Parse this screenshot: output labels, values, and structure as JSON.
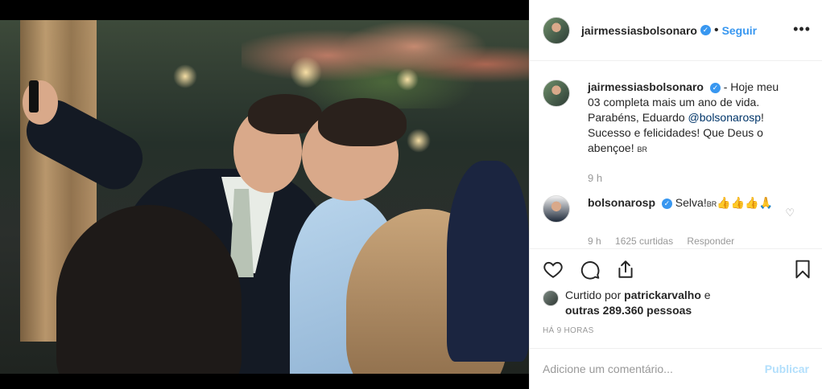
{
  "post": {
    "author": "jairmessiasbolsonaro",
    "verified": true,
    "separator": "•",
    "follow_label": "Seguir",
    "more_icon": "more-horizontal-icon",
    "accent": "#3897f0"
  },
  "caption": {
    "user": "jairmessiasbolsonaro",
    "text_before": " - Hoje meu 03 completa mais um ano de vida. Parabéns, Eduardo ",
    "mention": "@bolsonarosp",
    "text_after": "! Sucesso e felicidades! Que Deus o abençoe! ",
    "flag": "BR",
    "time": "9 h"
  },
  "comment": {
    "user": "bolsonarosp",
    "text": " Selva!",
    "flag": "BR",
    "emoji": "👍👍👍🙏",
    "meta_time": "9 h",
    "meta_likes": "1625 curtidas",
    "meta_reply": "Responder"
  },
  "likes": {
    "prefix": "Curtido por ",
    "user": "patrickarvalho",
    "middle": " e",
    "others": "outras 289.360 pessoas"
  },
  "timestamp": "HÁ 9 HORAS",
  "add_comment": {
    "placeholder": "Adicione um comentário...",
    "publish_label": "Publicar"
  }
}
